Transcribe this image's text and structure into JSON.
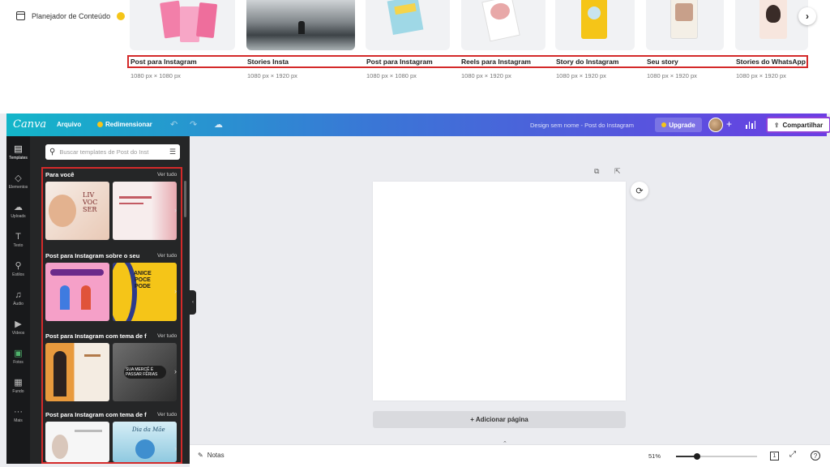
{
  "top": {
    "planner_label": "Planejador de Conteúdo",
    "templates": [
      {
        "title": "Post para Instagram",
        "size": "1080 px × 1080 px"
      },
      {
        "title": "Stories Insta",
        "size": "1080 px × 1920 px"
      },
      {
        "title": "Post para Instagram",
        "size": "1080 px × 1080 px"
      },
      {
        "title": "Reels para Instagram",
        "size": "1080 px × 1920 px"
      },
      {
        "title": "Story do Instagram",
        "size": "1080 px × 1920 px"
      },
      {
        "title": "Seu story",
        "size": "1080 px × 1920 px"
      },
      {
        "title": "Stories do WhatsApp",
        "size": "1080 px × 1920 px"
      }
    ]
  },
  "header": {
    "logo": "Canva",
    "file_menu": "Arquivo",
    "resize": "Redimensionar",
    "design_name": "Design sem nome - Post do Instagram",
    "upgrade": "Upgrade",
    "share": "Compartilhar"
  },
  "rail": {
    "items": [
      {
        "label": "Templates",
        "icon": "templates-icon"
      },
      {
        "label": "Elementos",
        "icon": "elements-icon"
      },
      {
        "label": "Uploads",
        "icon": "upload-icon"
      },
      {
        "label": "Texto",
        "icon": "text-icon"
      },
      {
        "label": "Estilos",
        "icon": "styles-icon"
      },
      {
        "label": "Áudio",
        "icon": "audio-icon"
      },
      {
        "label": "Vídeos",
        "icon": "video-icon"
      },
      {
        "label": "Fotos",
        "icon": "photos-icon"
      },
      {
        "label": "Fundo",
        "icon": "background-icon"
      },
      {
        "label": "Mais",
        "icon": "more-icon"
      }
    ]
  },
  "panel": {
    "search_placeholder": "Buscar templates de Post do Inst",
    "see_all": "Ver tudo",
    "sections": [
      {
        "title": "Para você",
        "thumb_texts": [
          "LIV\nVOC\nSER",
          ""
        ]
      },
      {
        "title": "Post para Instagram sobre o seu",
        "thumb_texts": [
          "",
          "ANICE\nPOCE\nPODE"
        ]
      },
      {
        "title": "Post para Instagram com tema de f",
        "thumb_texts": [
          "",
          "SUA MERCÊ É\nPASSAR FÊRIAS"
        ]
      },
      {
        "title": "Post para Instagram com tema de f",
        "thumb_texts": [
          "",
          "Dia da Mãe"
        ]
      }
    ]
  },
  "canvas": {
    "add_page": "+ Adicionar página"
  },
  "footer": {
    "notes": "Notas",
    "zoom": "51%",
    "zoom_fraction": 0.51,
    "page_count": "1"
  },
  "colors": {
    "header_start": "#13b6c9",
    "header_end": "#6b3de3",
    "highlight": "#d42a2a",
    "rail_bg": "#18191b",
    "panel_bg": "#252627"
  }
}
